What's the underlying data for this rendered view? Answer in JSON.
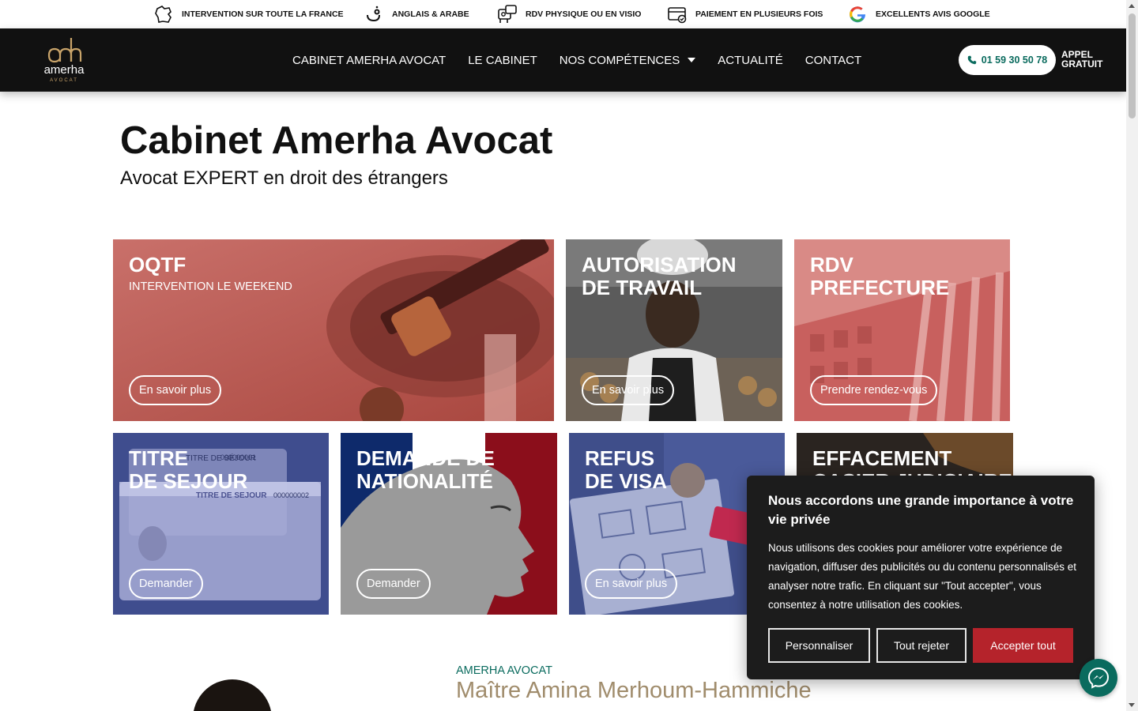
{
  "topbar": {
    "items": [
      {
        "label": "INTERVENTION SUR TOUTE LA FRANCE",
        "icon": "france-map-icon"
      },
      {
        "label": "ANGLAIS & ARABE",
        "icon": "arabic-letter-icon"
      },
      {
        "label": "RDV PHYSIQUE OU EN VISIO",
        "icon": "video-call-icon"
      },
      {
        "label": "PAIEMENT EN PLUSIEURS FOIS",
        "icon": "credit-card-icon"
      },
      {
        "label": "EXCELLENTS AVIS GOOGLE",
        "icon": "google-icon"
      }
    ]
  },
  "header": {
    "logo_text": "amerha",
    "logo_subtext": "AVOCAT",
    "nav": [
      {
        "label": "CABINET AMERHA AVOCAT"
      },
      {
        "label": "LE CABINET"
      },
      {
        "label": "NOS COMPÉTENCES",
        "has_dropdown": true
      },
      {
        "label": "ACTUALITÉ"
      },
      {
        "label": "CONTACT"
      }
    ],
    "phone": "01 59 30 50 78",
    "call_line1": "APPEL",
    "call_line2": "GRATUIT"
  },
  "hero": {
    "title_regular": "Cabinet ",
    "title_bold": "Amerha Avocat",
    "subtitle": "Avocat EXPERT en droit des étrangers"
  },
  "cards": [
    {
      "title": "OQTF",
      "subtitle": "INTERVENTION LE WEEKEND",
      "button": "En savoir plus"
    },
    {
      "title": "AUTORISATION\nDE TRAVAIL",
      "button": "En savoir plus"
    },
    {
      "title": "RDV\nPREFECTURE",
      "button": "Prendre rendez-vous"
    },
    {
      "title": "TITRE\nDE SEJOUR",
      "button": "Demander",
      "card_text_1": "TITRE DE SÉJOUR",
      "card_text_2": "000000001",
      "card_text_3": "TITRE DE SEJOUR",
      "card_text_4": "000000002"
    },
    {
      "title": "DEMANDE DE\nNATIONALITÉ",
      "button": "Demander"
    },
    {
      "title": "REFUS\nDE VISA",
      "button": "En savoir plus"
    },
    {
      "title": "EFFACEMENT\nCASIER JUDICIAIRE"
    }
  ],
  "about": {
    "label": "AMERHA AVOCAT",
    "name": "Maître Amina Merhoum-Hammiche"
  },
  "cookie": {
    "title": "Nous accordons une grande importance à votre vie privée",
    "text": "Nous utilisons des cookies pour améliorer votre expérience de navigation, diffuser des publicités ou du contenu personnalisés et analyser notre trafic. En cliquant sur \"Tout accepter\", vous consentez à notre utilisation des cookies.",
    "customize": "Personnaliser",
    "reject": "Tout rejeter",
    "accept": "Accepter tout"
  },
  "colors": {
    "header_bg": "#111111",
    "accent_teal": "#0a6b5e",
    "accent_gold": "#a08c6c",
    "accept_red": "#b5232b"
  }
}
